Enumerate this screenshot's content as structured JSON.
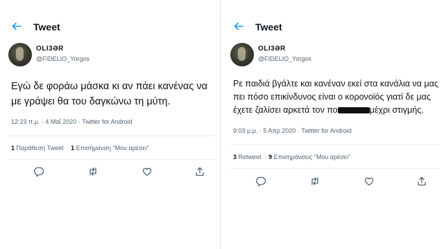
{
  "tweets": [
    {
      "header": {
        "back_icon": "arrow-left-icon",
        "title": "Tweet"
      },
      "author": {
        "display_name": "ΟLI3ƏR",
        "handle": "@FIDELIO_Yorgos"
      },
      "text": "Εγώ δε φοράω μάσκα κι αν πάει κανένας να με γράψει θα του δαγκώνω τη μύτη.",
      "meta": "12:23 π.μ. · 4 Μαΐ 2020 · Twitter for Android",
      "stats": [
        {
          "count": "1",
          "label": "Παράθεση Tweet"
        },
        {
          "count": "1",
          "label": "Επισήμανση \"Μου αρέσει\""
        }
      ],
      "actions": [
        "reply-icon",
        "retweet-icon",
        "like-icon",
        "share-icon"
      ]
    },
    {
      "header": {
        "back_icon": "arrow-left-icon",
        "title": "Tweet"
      },
      "author": {
        "display_name": "ΟLI3ƏR",
        "handle": "@FIDELIO_Yorgos"
      },
      "text_before": "Ρε παιδιά βγάλτε και κανέναν εκεί στα κανάλια να μας πει πόσο επικίνδυνος είναι ο κορονοϊός γιατί δε μας έχετε ζαλίσει αρκετά τον πο",
      "text_after": "μέχρι στιγμής.",
      "meta": "9:03 μ.μ. · 5 Απρ 2020 · Twitter for Android",
      "stats": [
        {
          "count": "3",
          "label": "Retweet"
        },
        {
          "count": "9",
          "label": "Επισημάνσεις \"Μου αρέσει\""
        }
      ],
      "actions": [
        "reply-icon",
        "retweet-icon",
        "like-icon",
        "share-icon"
      ]
    }
  ],
  "colors": {
    "accent": "#1d9bf0",
    "text": "#0f1419",
    "muted": "#536471"
  }
}
